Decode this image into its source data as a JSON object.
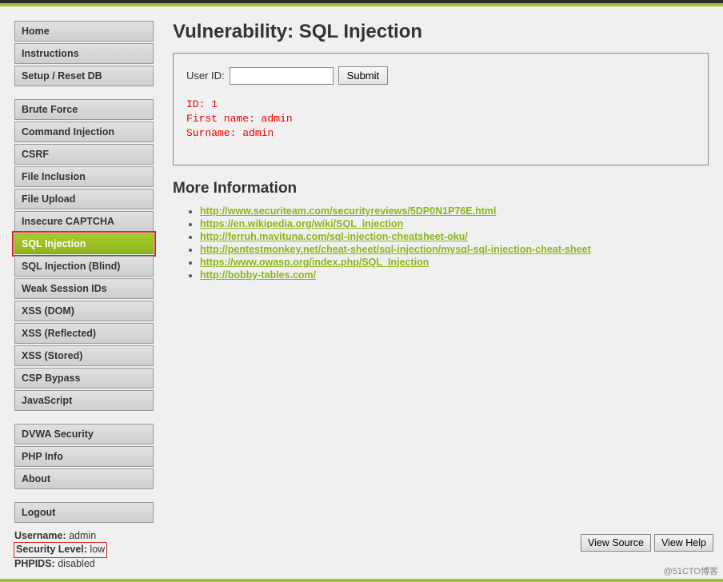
{
  "sidebar": {
    "group_main": [
      {
        "label": "Home",
        "active": false
      },
      {
        "label": "Instructions",
        "active": false
      },
      {
        "label": "Setup / Reset DB",
        "active": false
      }
    ],
    "group_vulns": [
      {
        "label": "Brute Force",
        "active": false
      },
      {
        "label": "Command Injection",
        "active": false
      },
      {
        "label": "CSRF",
        "active": false
      },
      {
        "label": "File Inclusion",
        "active": false
      },
      {
        "label": "File Upload",
        "active": false
      },
      {
        "label": "Insecure CAPTCHA",
        "active": false
      },
      {
        "label": "SQL Injection",
        "active": true,
        "highlighted": true
      },
      {
        "label": "SQL Injection (Blind)",
        "active": false
      },
      {
        "label": "Weak Session IDs",
        "active": false
      },
      {
        "label": "XSS (DOM)",
        "active": false
      },
      {
        "label": "XSS (Reflected)",
        "active": false
      },
      {
        "label": "XSS (Stored)",
        "active": false
      },
      {
        "label": "CSP Bypass",
        "active": false
      },
      {
        "label": "JavaScript",
        "active": false
      }
    ],
    "group_meta": [
      {
        "label": "DVWA Security",
        "active": false
      },
      {
        "label": "PHP Info",
        "active": false
      },
      {
        "label": "About",
        "active": false
      }
    ],
    "group_logout": [
      {
        "label": "Logout",
        "active": false
      }
    ]
  },
  "main": {
    "title": "Vulnerability: SQL Injection",
    "form": {
      "label": "User ID:",
      "input_value": "",
      "submit_label": "Submit"
    },
    "output": "ID: 1\nFirst name: admin\nSurname: admin",
    "more_info_heading": "More Information",
    "links": [
      "http://www.securiteam.com/securityreviews/5DP0N1P76E.html",
      "https://en.wikipedia.org/wiki/SQL_injection",
      "http://ferruh.mavituna.com/sql-injection-cheatsheet-oku/",
      "http://pentestmonkey.net/cheat-sheet/sql-injection/mysql-sql-injection-cheat-sheet",
      "https://www.owasp.org/index.php/SQL_Injection",
      "http://bobby-tables.com/"
    ]
  },
  "footer": {
    "username_label": "Username:",
    "username_value": "admin",
    "security_label": "Security Level:",
    "security_value": "low",
    "phpids_label": "PHPIDS:",
    "phpids_value": "disabled"
  },
  "actions": {
    "view_source": "View Source",
    "view_help": "View Help"
  },
  "watermark": "@51CTO博客"
}
